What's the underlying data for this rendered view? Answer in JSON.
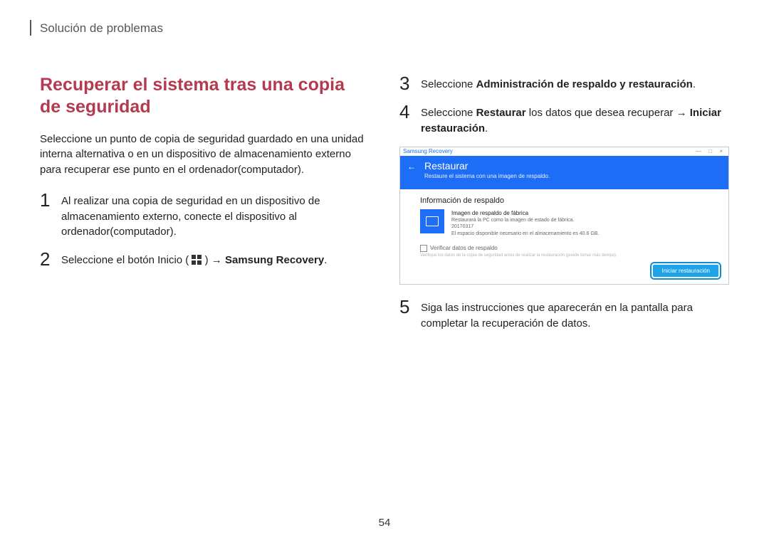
{
  "header": "Solución de problemas",
  "pageNumber": "54",
  "left": {
    "title": "Recuperar el sistema tras una copia de seguridad",
    "intro": "Seleccione un punto de copia de seguridad guardado en una unidad interna alternativa o en un dispositivo de almacenamiento externo para recuperar ese punto en el ordenador(computador).",
    "step1": "Al realizar una copia de seguridad en un dispositivo de almacenamiento externo, conecte el dispositivo al ordenador(computador).",
    "step2_a": "Seleccione el botón Inicio (",
    "step2_b": ") → ",
    "step2_bold": "Samsung Recovery",
    "step2_c": "."
  },
  "right": {
    "step3_a": "Seleccione ",
    "step3_bold": "Administración de respaldo y restauración",
    "step3_c": ".",
    "step4_a": "Seleccione ",
    "step4_bold1": "Restaurar",
    "step4_b": " los datos que desea recuperar → ",
    "step4_bold2": "Iniciar restauración",
    "step4_c": ".",
    "step5": "Siga las instrucciones que aparecerán en la pantalla para completar la recuperación de datos."
  },
  "shot": {
    "appName": "Samsung Recovery",
    "winButtons": "— □ ×",
    "blueTitle": "Restaurar",
    "blueSub": "Restaure el sistema con una imagen de respaldo.",
    "infoTitle": "Información de respaldo",
    "line1": "Imagen de respaldo de fábrica",
    "line2": "Restaurará la PC como la imagen de estado de fábrica.",
    "line3": "20170317",
    "line4": "El espacio disponible necesario en el almacenamiento es 40.6 GB.",
    "verifyTitle": "Verificar datos de respaldo",
    "verifyLine": "Verifique los datos de la copia de seguridad antes de realizar la restauración (puede tomar más tiempo).",
    "button": "Iniciar restauración"
  }
}
